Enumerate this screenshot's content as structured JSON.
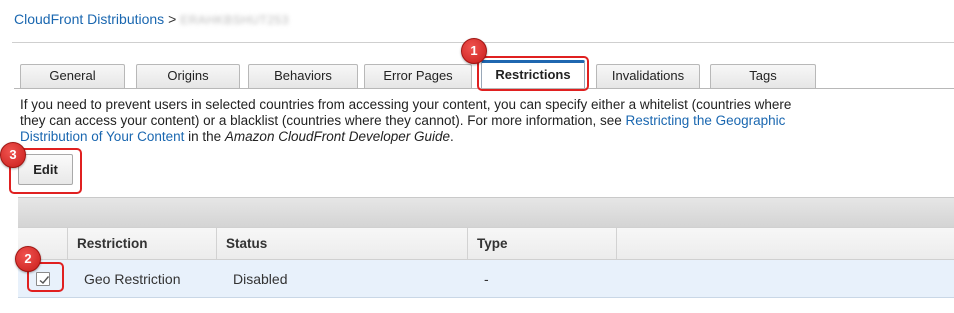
{
  "breadcrumb": {
    "root_label": "CloudFront Distributions",
    "separator": ">",
    "distribution_id": "ERAHKBSHUT253"
  },
  "tabs": [
    {
      "label": "General",
      "active": false
    },
    {
      "label": "Origins",
      "active": false
    },
    {
      "label": "Behaviors",
      "active": false
    },
    {
      "label": "Error Pages",
      "active": false
    },
    {
      "label": "Restrictions",
      "active": true
    },
    {
      "label": "Invalidations",
      "active": false
    },
    {
      "label": "Tags",
      "active": false
    }
  ],
  "description": {
    "text_before": "If you need to prevent users in selected countries from accessing your content, you can specify either a whitelist (countries where they can access your content) or a blacklist (countries where they cannot). For more information, see",
    "link_text": "Restricting the Geographic Distribution of Your Content",
    "text_middle": "in the",
    "guide_title": "Amazon CloudFront Developer Guide",
    "text_end": "."
  },
  "toolbar": {
    "edit_label": "Edit"
  },
  "table": {
    "columns": [
      "Restriction",
      "Status",
      "Type"
    ],
    "rows": [
      {
        "restriction": "Geo Restriction",
        "status": "Disabled",
        "type": "-",
        "selected": true
      }
    ]
  },
  "annotations": [
    "1",
    "2",
    "3"
  ],
  "colors": {
    "link": "#1a67b0",
    "active_tab_accent": "#1f67b0",
    "annotation_red": "#e02020",
    "selected_row": "#e8f1fb"
  }
}
